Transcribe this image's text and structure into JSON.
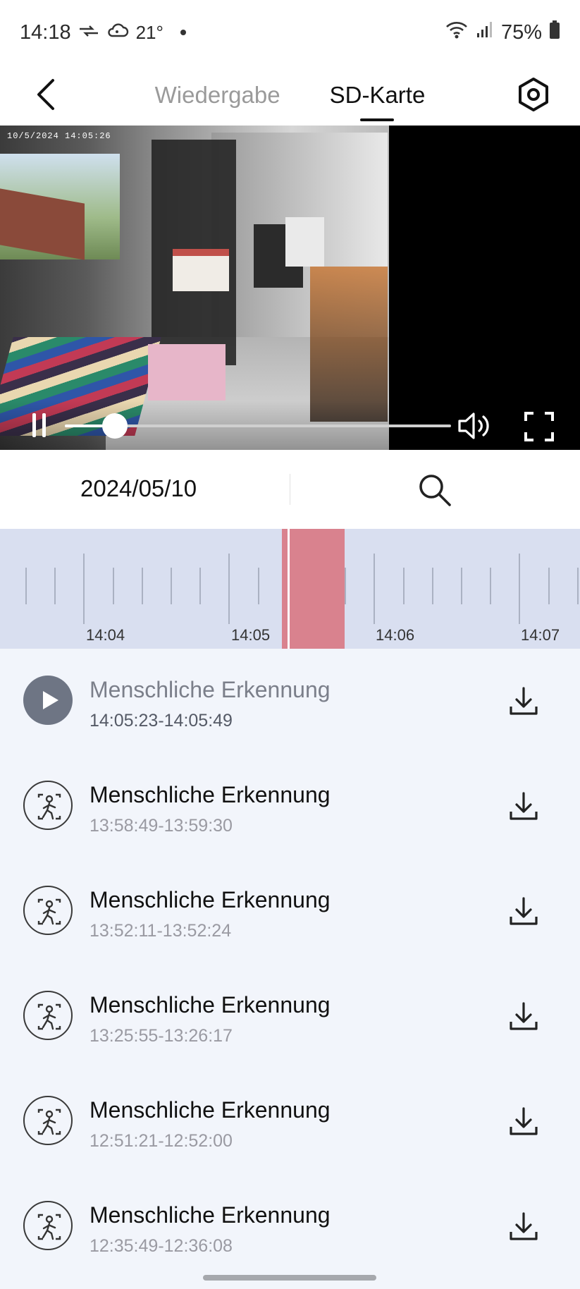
{
  "status_bar": {
    "time": "14:18",
    "weather": "21°",
    "battery": "75%"
  },
  "header": {
    "tabs": [
      {
        "label": "Wiedergabe",
        "active": false
      },
      {
        "label": "SD-Karte",
        "active": true
      }
    ]
  },
  "video": {
    "timestamp": "10/5/2024  14:05:26",
    "progress": 0.13
  },
  "date_bar": {
    "date": "2024/05/10"
  },
  "timeline": {
    "labels": [
      "14:04",
      "14:05",
      "14:06",
      "14:07"
    ]
  },
  "events": [
    {
      "title": "Menschliche Erkennung",
      "time": "14:05:23-14:05:49",
      "played": true
    },
    {
      "title": "Menschliche Erkennung",
      "time": "13:58:49-13:59:30",
      "played": false
    },
    {
      "title": "Menschliche Erkennung",
      "time": "13:52:11-13:52:24",
      "played": false
    },
    {
      "title": "Menschliche Erkennung",
      "time": "13:25:55-13:26:17",
      "played": false
    },
    {
      "title": "Menschliche Erkennung",
      "time": "12:51:21-12:52:00",
      "played": false
    },
    {
      "title": "Menschliche Erkennung",
      "time": "12:35:49-12:36:08",
      "played": false
    }
  ],
  "colors": {
    "timeline_bg": "#d9dff0",
    "timeline_highlight": "#d9828e",
    "list_bg": "#f2f5fb",
    "play_icon_bg": "#6e7584"
  }
}
